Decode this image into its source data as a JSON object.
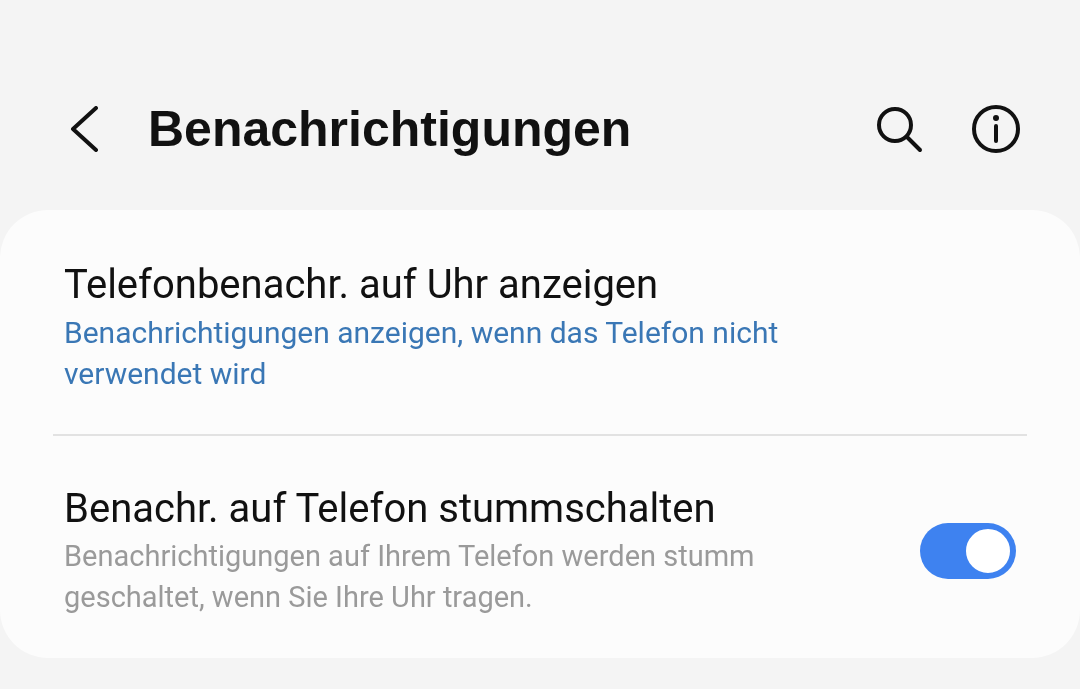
{
  "header": {
    "title": "Benachrichtigungen"
  },
  "items": [
    {
      "kind": "value",
      "title": "Telefonbenachr. auf Uhr anzeigen",
      "summary": "Benachrichtigungen anzeigen, wenn das Telefon nicht verwendet wird"
    },
    {
      "kind": "toggle",
      "title": "Benachr. auf Telefon stummschalten",
      "summary": "Benachrichtigungen auf Ihrem Telefon werden stumm geschaltet, wenn Sie Ihre Uhr tragen.",
      "on": true
    }
  ]
}
